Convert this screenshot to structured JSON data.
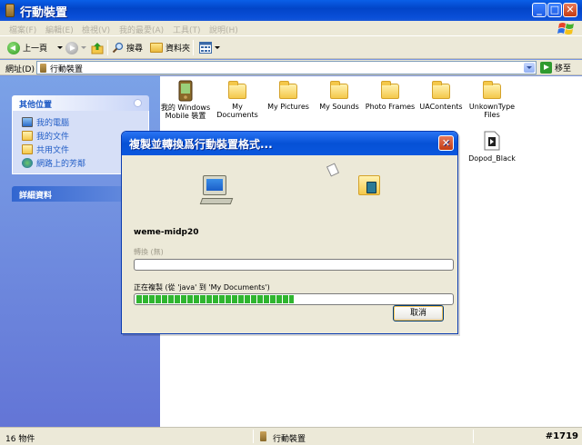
{
  "window": {
    "title": "行動裝置",
    "controls": {
      "minimize": "_",
      "maximize": "□",
      "close": "✕"
    }
  },
  "menubar": {
    "items": [
      "檔案(F)",
      "編輯(E)",
      "檢視(V)",
      "我的最愛(A)",
      "工具(T)",
      "說明(H)"
    ]
  },
  "toolbar": {
    "back_label": "上一頁",
    "search_label": "搜尋",
    "folders_label": "資料夾"
  },
  "address": {
    "label": "網址(D)",
    "value": "行動裝置",
    "go_label": "移至"
  },
  "sidebar": {
    "other_places": {
      "title": "其他位置",
      "items": [
        "我的電腦",
        "我的文件",
        "共用文件",
        "網路上的芳鄰"
      ]
    },
    "details": {
      "title": "詳細資料"
    }
  },
  "content": {
    "items": [
      {
        "label": "我的 Windows Mobile 裝置",
        "icon": "pda-icon"
      },
      {
        "label": "My Documents",
        "icon": "folder-icon"
      },
      {
        "label": "My Pictures",
        "icon": "folder-icon"
      },
      {
        "label": "My Sounds",
        "icon": "folder-icon"
      },
      {
        "label": "Photo Frames",
        "icon": "folder-icon"
      },
      {
        "label": "UAContents",
        "icon": "folder-icon"
      },
      {
        "label": "UnkownType Files",
        "icon": "folder-icon"
      },
      {
        "label": "Dopod_Black",
        "icon": "file-icon"
      }
    ]
  },
  "statusbar": {
    "count": "16 物件",
    "location": "行動裝置",
    "watermark": "#1719"
  },
  "dialog": {
    "title": "複製並轉換爲行動裝置格式...",
    "close": "✕",
    "filename": "weme-midp20",
    "convert_label": "轉換 (無)",
    "copy_label": "正在複製 (從 'java' 到 'My Documents')",
    "copy_progress": 0.5,
    "convert_progress": 0,
    "cancel_label": "取消"
  }
}
